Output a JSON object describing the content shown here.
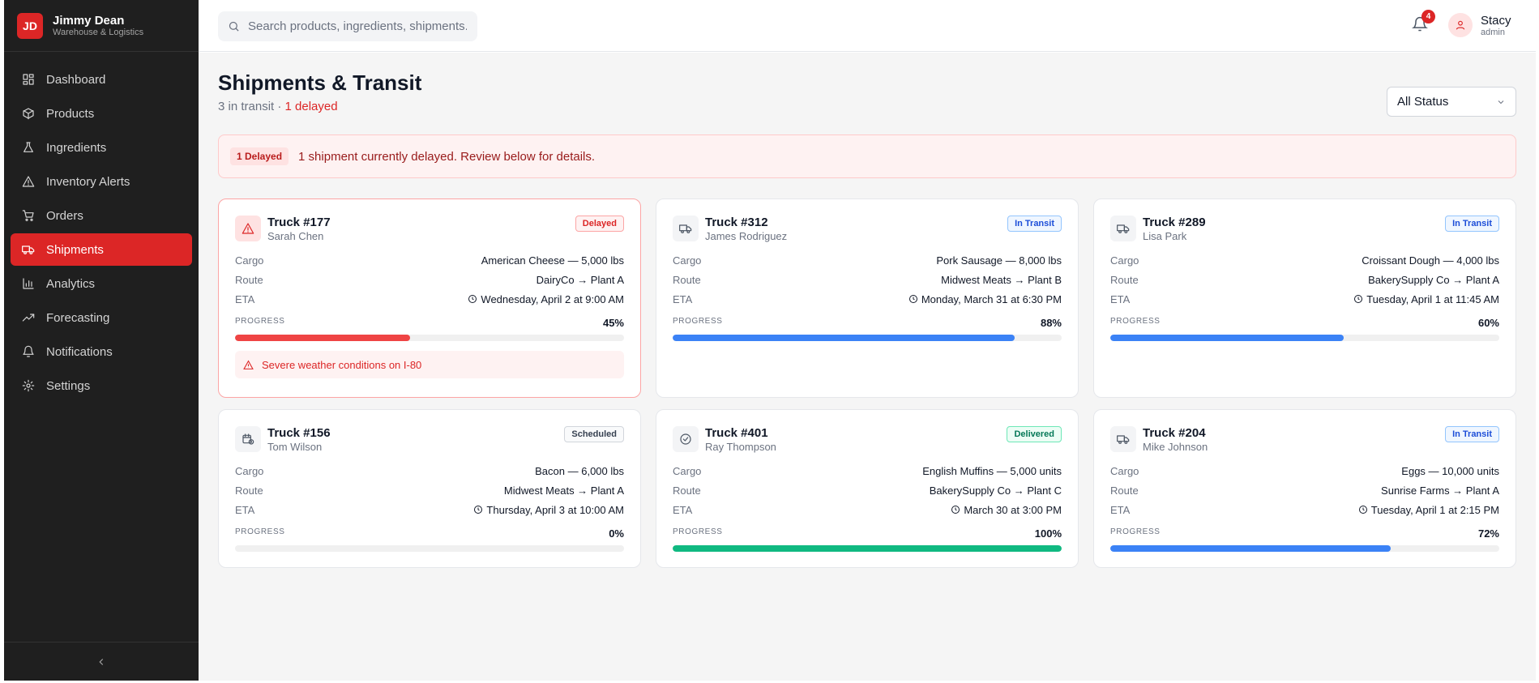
{
  "brand": {
    "logo": "JD",
    "name": "Jimmy Dean",
    "subtitle": "Warehouse & Logistics"
  },
  "sidebar": {
    "items": [
      {
        "label": "Dashboard",
        "icon": "dashboard-icon"
      },
      {
        "label": "Products",
        "icon": "box-icon"
      },
      {
        "label": "Ingredients",
        "icon": "flask-icon"
      },
      {
        "label": "Inventory Alerts",
        "icon": "warning-icon"
      },
      {
        "label": "Orders",
        "icon": "cart-icon"
      },
      {
        "label": "Shipments",
        "icon": "truck-icon",
        "active": true
      },
      {
        "label": "Analytics",
        "icon": "bar-chart-icon"
      },
      {
        "label": "Forecasting",
        "icon": "trend-icon"
      },
      {
        "label": "Notifications",
        "icon": "bell-icon"
      },
      {
        "label": "Settings",
        "icon": "gear-icon"
      }
    ]
  },
  "topbar": {
    "search_placeholder": "Search products, ingredients, shipments...",
    "notification_count": "4",
    "user_name": "Stacy",
    "user_role": "admin"
  },
  "page": {
    "title": "Shipments & Transit",
    "subtitle_prefix": "3 in transit · ",
    "subtitle_delayed": "1 delayed",
    "filter_value": "All Status"
  },
  "banner": {
    "pill": "1 Delayed",
    "text": "1 shipment currently delayed. Review below for details."
  },
  "labels": {
    "cargo": "Cargo",
    "route": "Route",
    "eta": "ETA",
    "progress": "PROGRESS"
  },
  "colors": {
    "accent": "#dc2626",
    "transit": "#3b82f6",
    "delivered": "#10b981",
    "delayed": "#ef4444"
  },
  "shipments": [
    {
      "truck": "Truck #177",
      "driver": "Sarah Chen",
      "status": "Delayed",
      "cargo": "American Cheese — 5,000 lbs",
      "route": "DairyCo → Plant A",
      "eta": "Wednesday, April 2 at 9:00 AM",
      "progress": 45,
      "progress_text": "45%",
      "alert": "Severe weather conditions on I-80"
    },
    {
      "truck": "Truck #312",
      "driver": "James Rodriguez",
      "status": "In Transit",
      "cargo": "Pork Sausage — 8,000 lbs",
      "route": "Midwest Meats → Plant B",
      "eta": "Monday, March 31 at 6:30 PM",
      "progress": 88,
      "progress_text": "88%"
    },
    {
      "truck": "Truck #289",
      "driver": "Lisa Park",
      "status": "In Transit",
      "cargo": "Croissant Dough — 4,000 lbs",
      "route": "BakerySupply Co → Plant A",
      "eta": "Tuesday, April 1 at 11:45 AM",
      "progress": 60,
      "progress_text": "60%"
    },
    {
      "truck": "Truck #156",
      "driver": "Tom Wilson",
      "status": "Scheduled",
      "cargo": "Bacon — 6,000 lbs",
      "route": "Midwest Meats → Plant A",
      "eta": "Thursday, April 3 at 10:00 AM",
      "progress": 0,
      "progress_text": "0%"
    },
    {
      "truck": "Truck #401",
      "driver": "Ray Thompson",
      "status": "Delivered",
      "cargo": "English Muffins — 5,000 units",
      "route": "BakerySupply Co → Plant C",
      "eta": "March 30 at 3:00 PM",
      "progress": 100,
      "progress_text": "100%"
    },
    {
      "truck": "Truck #204",
      "driver": "Mike Johnson",
      "status": "In Transit",
      "cargo": "Eggs — 10,000 units",
      "route": "Sunrise Farms → Plant A",
      "eta": "Tuesday, April 1 at 2:15 PM",
      "progress": 72,
      "progress_text": "72%"
    }
  ]
}
